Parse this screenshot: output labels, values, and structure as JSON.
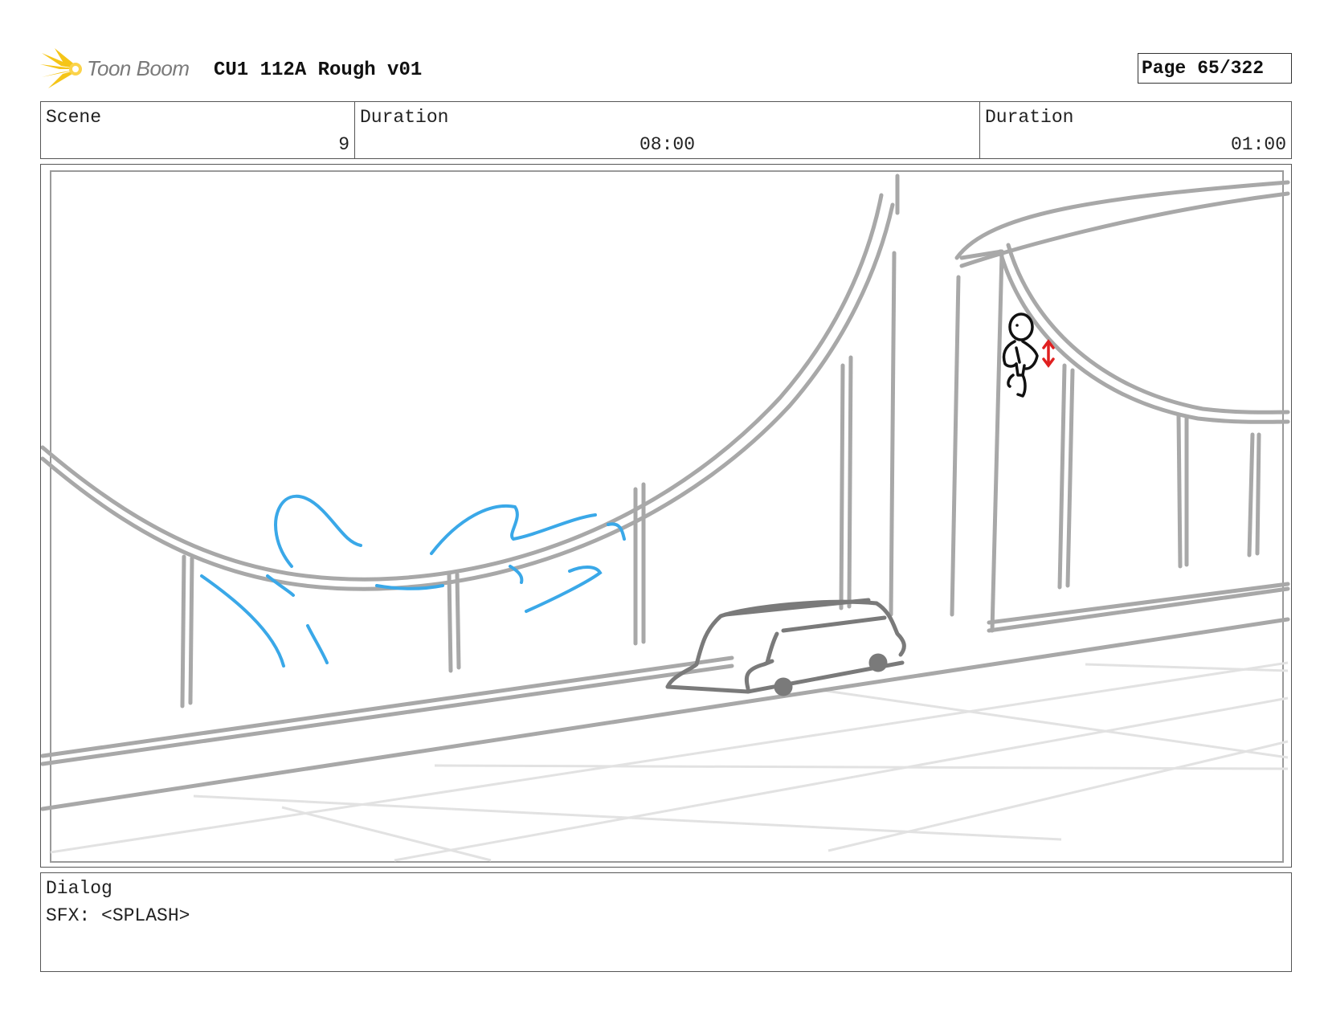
{
  "header": {
    "logo_text": "Toon Boom",
    "project_title": "CU1 112A Rough v01",
    "page_label": "Page",
    "page_value": "65/322"
  },
  "info": {
    "scene_label": "Scene",
    "scene_value": "9",
    "duration1_label": "Duration",
    "duration1_value": "08:00",
    "duration2_label": "Duration",
    "duration2_value": "01:00"
  },
  "panel": {
    "drawing": "storyboard-sketch"
  },
  "dialog": {
    "label": "Dialog",
    "text": "SFX: <SPLASH>"
  },
  "colors": {
    "logo_accent": "#f5c518",
    "sketch_gray": "#a8a8a8",
    "sketch_dark": "#7a7a7a",
    "splash_blue": "#3aa8e8",
    "marker_red": "#e02020"
  }
}
